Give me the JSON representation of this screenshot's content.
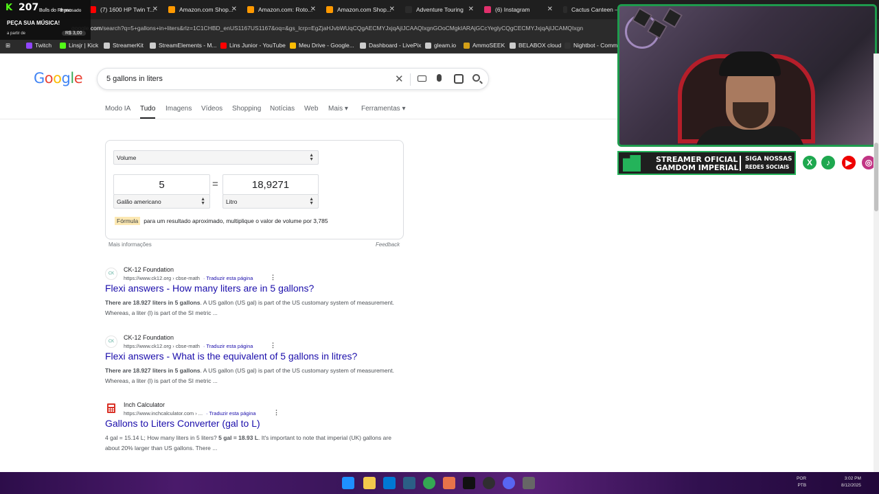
{
  "tabs": [
    {
      "label": "(7) 1600 HP Twin T...",
      "color": "#ff0000"
    },
    {
      "label": "Amazon.com Shop...",
      "color": "#ff9900"
    },
    {
      "label": "Amazon.com: Roto...",
      "color": "#ff9900"
    },
    {
      "label": "Amazon.com Shop...",
      "color": "#ff9900"
    },
    {
      "label": "Adventure Touring",
      "color": "#2b2b2b"
    },
    {
      "label": "(6) Instagram",
      "color": "#e1306c"
    },
    {
      "label": "Cactus Canteen –",
      "color": "#2b2b2b"
    }
  ],
  "address": {
    "host": "google.com",
    "path": "/search?q=5+gallons+in+liters&rlz=1C1CHBD_enUS1167US1167&oq=&gs_lcrp=EgZjaHJvbWUqCQgAECMYJxjqAjIJCAAQIxgnGOoCMgkIARAjGCcYeglyCQgCECMYJxjqAjIJCAMQIxgn"
  },
  "bookmarks": [
    {
      "label": "Twitch",
      "color": "#9146ff"
    },
    {
      "label": "Linsjr | Kick",
      "color": "#53fc18"
    },
    {
      "label": "StreamerKit",
      "color": "#cccccc"
    },
    {
      "label": "StreamElements - M...",
      "color": "#cccccc"
    },
    {
      "label": "Lins Junior - YouTube",
      "color": "#ff0000"
    },
    {
      "label": "Meu Drive - Google...",
      "color": "#fbbc04"
    },
    {
      "label": "Dashboard - LivePix",
      "color": "#cccccc"
    },
    {
      "label": "gleam.io",
      "color": "#cccccc"
    },
    {
      "label": "AmmoSEEK",
      "color": "#d4a017"
    },
    {
      "label": "BELABOX cloud",
      "color": "#cccccc"
    },
    {
      "label": "Nightbot - Comm...",
      "color": "#333333"
    }
  ],
  "overlay": {
    "count": "207",
    "who": "Bulls do Rhyno",
    "status": "II pausado",
    "cta": "PEÇA SUA MÚSICA!",
    "from": "a partir de",
    "price": "R$ 3,00"
  },
  "google": {
    "query": "5 gallons in liters",
    "tabs": [
      {
        "label": "Modo IA"
      },
      {
        "label": "Tudo",
        "active": true
      },
      {
        "label": "Imagens"
      },
      {
        "label": "Vídeos"
      },
      {
        "label": "Shopping"
      },
      {
        "label": "Notícias"
      },
      {
        "label": "Web"
      },
      {
        "label": "Mais ▾"
      },
      {
        "label": "Ferramentas ▾"
      }
    ]
  },
  "converter": {
    "unit_type": "Volume",
    "from_value": "5",
    "to_value": "18,9271",
    "from_unit": "Galão americano",
    "to_unit": "Litro",
    "formula_tag": "Fórmula",
    "formula_text": "para um resultado aproximado, multiplique o valor de volume por 3,785",
    "more_info": "Mais informações",
    "feedback": "Feedback"
  },
  "results": [
    {
      "site": "CK-12 Foundation",
      "crumb": "https://www.ck12.org › cbse-math",
      "translate": "· Traduzir esta página",
      "title": "Flexi answers - How many liters are in 5 gallons?",
      "snippet_bold": "There are 18.927 liters in 5 gallons",
      "snippet_rest": ". A US gallon (US gal) is part of the US customary system of measurement. Whereas, a liter (l) is part of the SI metric ...",
      "fav": "ck-12-logo"
    },
    {
      "site": "CK-12 Foundation",
      "crumb": "https://www.ck12.org › cbse-math",
      "translate": "· Traduzir esta página",
      "title": "Flexi answers - What is the equivalent of 5 gallons in litres?",
      "snippet_bold": "There are 18.927 liters in 5 gallons",
      "snippet_rest": ". A US gallon (US gal) is part of the US customary system of measurement. Whereas, a liter (l) is part of the SI metric ...",
      "fav": "ck-12-logo"
    },
    {
      "site": "Inch Calculator",
      "crumb": "https://www.inchcalculator.com › ...",
      "translate": "· Traduzir esta página",
      "title": "Gallons to Liters Converter (gal to L)",
      "snippet_pre": "4 gal = 15.14 L; How many liters in 5 liters? ",
      "snippet_bold": "5 gal = 18.93 L",
      "snippet_rest": ". It's important to note that imperial (UK) gallons are about 20% larger than US gallons. There ...",
      "fav": "calculator-icon"
    }
  ],
  "stream_banner": {
    "line1": "STREAMER OFICIAL",
    "line2": "GAMDOM IMPERIAL",
    "right1": "SIGA NOSSAS",
    "right2": "REDES SOCIAIS"
  },
  "socials": [
    {
      "icon": "x-icon",
      "glyph": "X"
    },
    {
      "icon": "tiktok-icon",
      "glyph": "♪"
    },
    {
      "icon": "youtube-icon",
      "glyph": "▶"
    },
    {
      "icon": "instagram-icon",
      "glyph": "◎"
    }
  ],
  "tray": {
    "lang1": "POR",
    "lang2": "PTB",
    "time": "3:02 PM",
    "date": "8/12/2025"
  }
}
